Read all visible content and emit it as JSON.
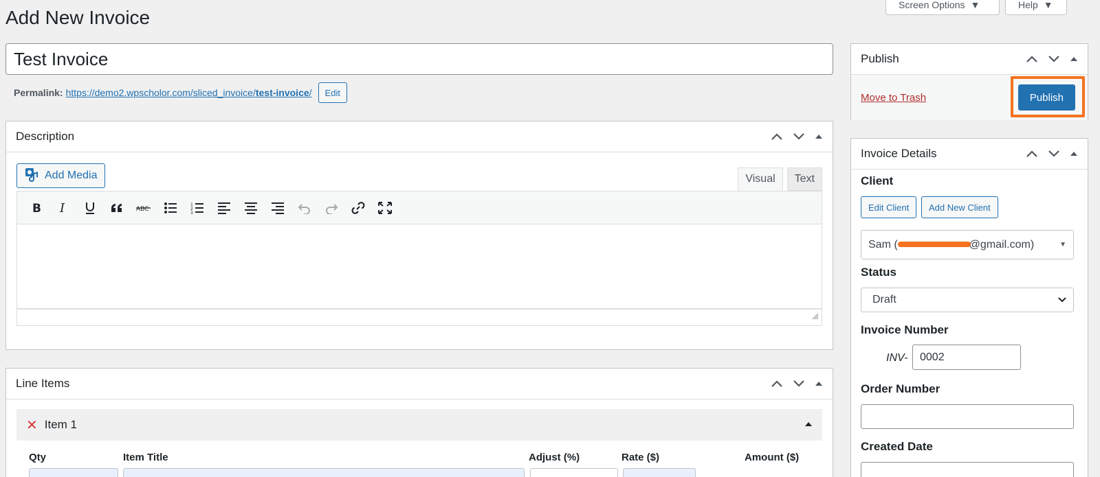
{
  "header": {
    "title": "Add New Invoice",
    "screen_options_label": "Screen Options",
    "help_label": "Help"
  },
  "post": {
    "title": "Test Invoice",
    "permalink_label": "Permalink:",
    "permalink_base": "https://demo2.wpscholor.com/sliced_invoice/",
    "permalink_slug": "test-invoice",
    "permalink_trailing": "/",
    "edit_label": "Edit"
  },
  "description": {
    "title": "Description",
    "add_media_label": "Add Media",
    "tab_visual": "Visual",
    "tab_text": "Text"
  },
  "line_items": {
    "title": "Line Items",
    "item_title": "Item 1",
    "columns": [
      "Qty",
      "Item Title",
      "Adjust (%)",
      "Rate ($)",
      "Amount ($)"
    ]
  },
  "publish": {
    "title": "Publish",
    "trash_label": "Move to Trash",
    "publish_label": "Publish",
    "highlight_color": "#f4731f"
  },
  "invoice_details": {
    "title": "Invoice Details",
    "client_label": "Client",
    "edit_client_label": "Edit Client",
    "add_client_label": "Add New Client",
    "client_value_prefix": "Sam (",
    "client_value_suffix": "@gmail.com)",
    "status_label": "Status",
    "status_value": "Draft",
    "invoice_number_label": "Invoice Number",
    "invoice_prefix": "INV-",
    "invoice_number": "0002",
    "order_number_label": "Order Number",
    "order_number": "",
    "created_date_label": "Created Date"
  },
  "colors": {
    "accent": "#2271b1",
    "danger": "#b32d2e",
    "background": "#f0f0f1"
  }
}
